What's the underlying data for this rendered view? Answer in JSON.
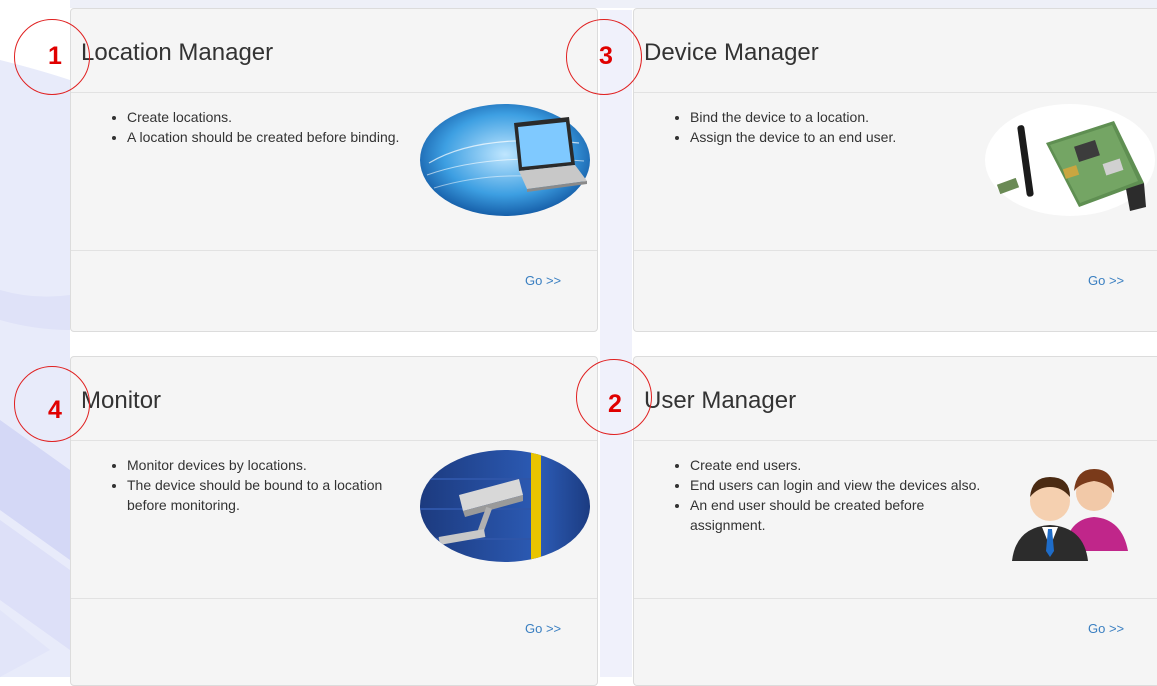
{
  "cards": {
    "location": {
      "title": "Location Manager",
      "items": [
        "Create locations.",
        "A location should be created before binding."
      ],
      "go_label": "Go >>",
      "illustration": "laptop-network-icon"
    },
    "device": {
      "title": "Device Manager",
      "items": [
        "Bind the device to a location.",
        "Assign the device to an end user."
      ],
      "go_label": "Go >>",
      "illustration": "device-board-icon"
    },
    "monitor": {
      "title": "Monitor",
      "items": [
        "Monitor devices by locations.",
        "The device should be bound to a location before monitoring."
      ],
      "go_label": "Go >>",
      "illustration": "security-camera-icon"
    },
    "user": {
      "title": "User Manager",
      "items": [
        "Create end users.",
        "End users can login and view the devices also.",
        "An end user should be created before assignment."
      ],
      "go_label": "Go >>",
      "illustration": "users-icon"
    }
  },
  "markers": [
    "1",
    "3",
    "4",
    "2"
  ],
  "colors": {
    "card_bg": "#f5f5f5",
    "link": "#3a7fc1",
    "marker": "#e00000",
    "decor": "#c9cdf0"
  }
}
